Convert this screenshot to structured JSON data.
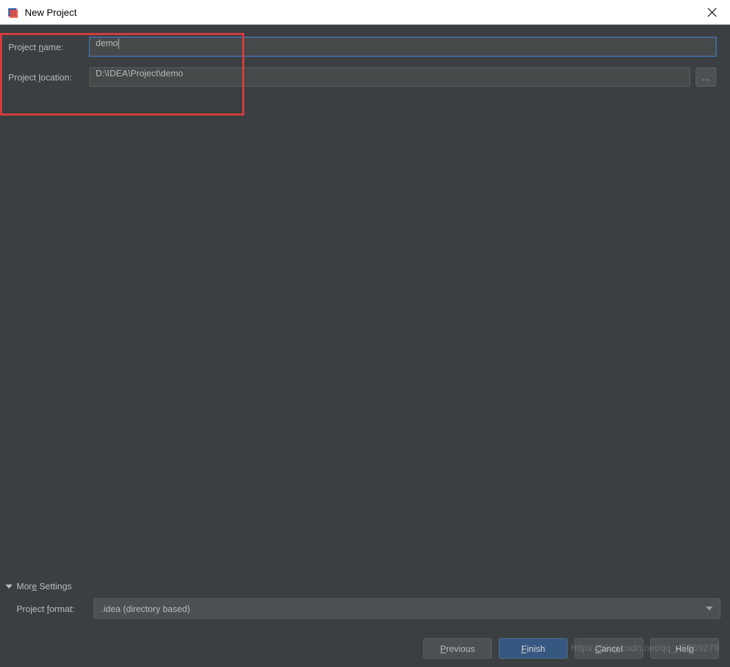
{
  "window": {
    "title": "New Project"
  },
  "form": {
    "name_label_pre": "Project ",
    "name_label_u": "n",
    "name_label_post": "ame:",
    "name_value": "demo",
    "location_label_pre": "Project ",
    "location_label_u": "l",
    "location_label_post": "ocation:",
    "location_value": "D:\\IDEA\\Project\\demo",
    "browse_label": "..."
  },
  "more": {
    "header_pre": "Mor",
    "header_u": "e",
    "header_post": " Settings",
    "format_label_pre": "Project ",
    "format_label_u": "f",
    "format_label_post": "ormat:",
    "format_value": ".idea (directory based)"
  },
  "buttons": {
    "previous_u": "P",
    "previous_post": "revious",
    "finish_u": "F",
    "finish_post": "inish",
    "cancel_pre": "",
    "cancel_u": "C",
    "cancel_post": "ancel",
    "help_pre": "Hel",
    "help_u": "p",
    "help_post": ""
  },
  "watermark": "https://blog.csdn.net/qq_45069279"
}
